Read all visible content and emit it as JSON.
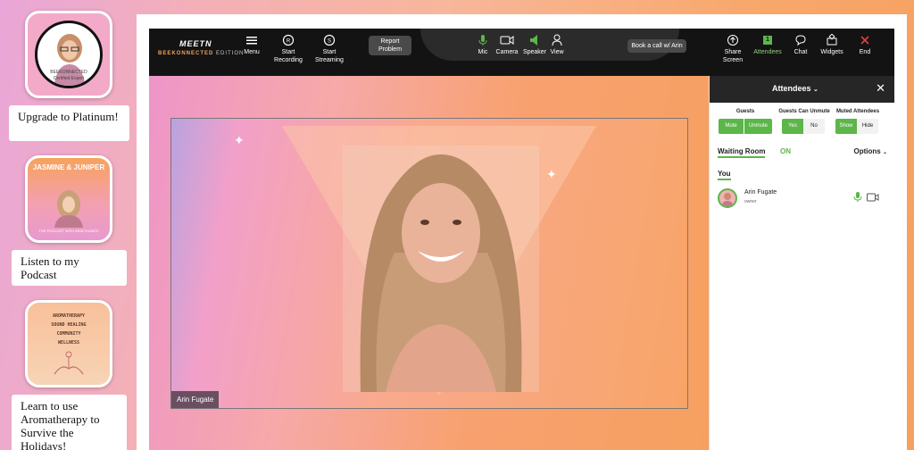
{
  "promos": [
    {
      "label": "Upgrade to Platinum!",
      "brand": "BEEKONNECTED",
      "sub": "Certified Expert"
    },
    {
      "label": "Listen to my Podcast",
      "title": "JASMINE & JUNIPER",
      "sub": "THE PODCAST WITH ARIN FUGATE"
    },
    {
      "label": "Learn to use Aromatherapy to Survive the Holidays!",
      "lines": [
        "AROMATHERAPY",
        "SOUND HEALING",
        "COMMUNITY",
        "WELLNESS"
      ]
    }
  ],
  "toolbar": {
    "brand_top": "MEETN",
    "brand_bottom_accent": "BEEKONNECTED",
    "brand_bottom_rest": "EDITION",
    "menu": "Menu",
    "start_recording": "Start Recording",
    "start_streaming": "Start Streaming",
    "report_problem": "Report Problem",
    "mic": "Mic",
    "camera": "Camera",
    "speaker": "Speaker",
    "view": "View",
    "book_call": "Book a call w/ Arin",
    "share_screen": "Share Screen",
    "attendees": "Attendees",
    "attendees_count": "1",
    "chat": "Chat",
    "widgets": "Widgets",
    "end": "End"
  },
  "video": {
    "participant_name": "Arin Fugate"
  },
  "panel": {
    "title": "Attendees",
    "guests_label": "Guests",
    "guests_options": [
      "Mute",
      "Unmute"
    ],
    "unmute_label": "Guests Can Unmute",
    "unmute_options": [
      "Yes",
      "No"
    ],
    "muted_label": "Muted Attendees",
    "muted_options": [
      "Show",
      "Hide"
    ],
    "waiting_room": "Waiting Room",
    "waiting_state": "ON",
    "options": "Options",
    "you_heading": "You",
    "attendee_name": "Arin Fugate",
    "attendee_role": "owner"
  },
  "colors": {
    "accent_green": "#5cb64a",
    "toolbar_bg": "#131313",
    "brand_orange": "#f2a35a"
  }
}
